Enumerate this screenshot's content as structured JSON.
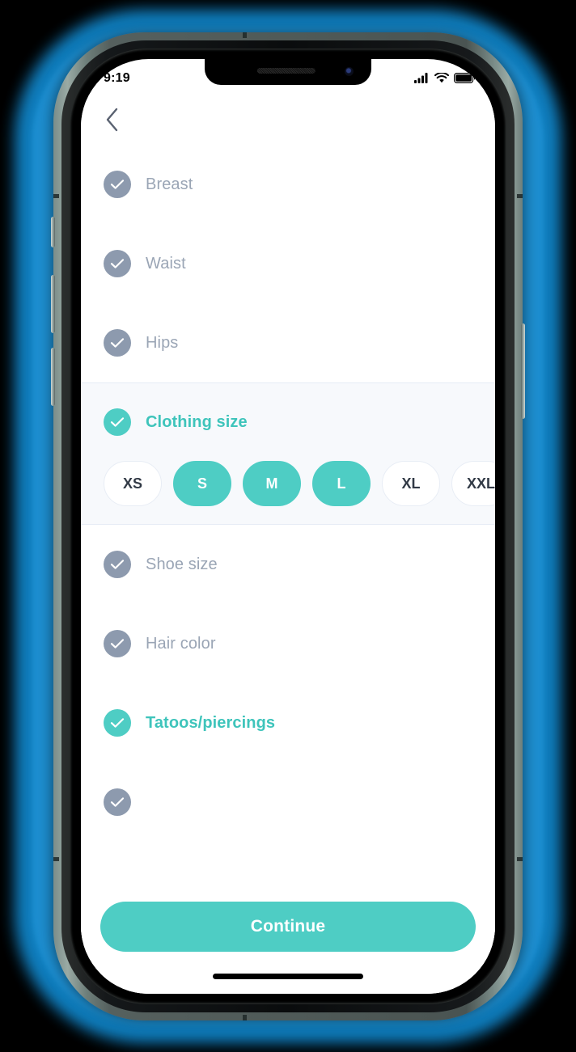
{
  "status_bar": {
    "time": "9:19",
    "icons": [
      "signal-bars-icon",
      "wifi-icon",
      "battery-icon"
    ]
  },
  "nav": {
    "back_icon": "chevron-left-icon"
  },
  "colors": {
    "accent_teal": "#4ECDC4",
    "inactive_gray": "#8D9AAE",
    "label_gray": "#9AA5B5",
    "section_bg": "#F7F9FC",
    "glow_blue": "#1189CF"
  },
  "list": {
    "items_top": [
      {
        "label": "Breast",
        "state": "inactive",
        "icon": "check-circle-icon"
      },
      {
        "label": "Waist",
        "state": "inactive",
        "icon": "check-circle-icon"
      },
      {
        "label": "Hips",
        "state": "inactive",
        "icon": "check-circle-icon"
      }
    ],
    "highlighted_section": {
      "label": "Clothing size",
      "state": "active",
      "icon": "check-circle-icon",
      "options": [
        {
          "label": "XS",
          "selected": false
        },
        {
          "label": "S",
          "selected": true
        },
        {
          "label": "M",
          "selected": true
        },
        {
          "label": "L",
          "selected": true
        },
        {
          "label": "XL",
          "selected": false
        },
        {
          "label": "XXL",
          "selected": false
        }
      ]
    },
    "items_bottom": [
      {
        "label": "Shoe size",
        "state": "inactive",
        "icon": "check-circle-icon"
      },
      {
        "label": "Hair color",
        "state": "inactive",
        "icon": "check-circle-icon"
      },
      {
        "label": "Tatoos/piercings",
        "state": "active",
        "icon": "check-circle-icon"
      }
    ],
    "partial_item": {
      "label": "",
      "state": "inactive",
      "icon": "check-circle-icon"
    }
  },
  "bottom": {
    "continue_label": "Continue"
  }
}
